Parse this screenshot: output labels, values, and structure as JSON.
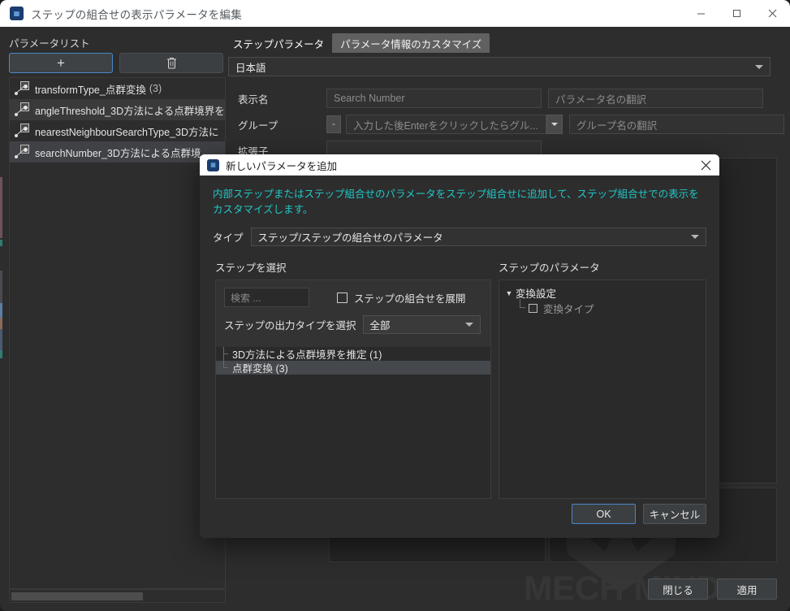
{
  "window": {
    "title": "ステップの組合せの表示パラメータを編集",
    "icon": "app-icon",
    "minimize_label": "minimize-icon",
    "maximize_label": "maximize-icon",
    "close_label": "close-icon"
  },
  "left_pane": {
    "label": "パラメータリスト",
    "add_button": "+",
    "delete_button": "🗑",
    "items": [
      {
        "label": "transformType_点群変換",
        "count": "(3)"
      },
      {
        "label": "angleThreshold_3D方法による点群境界を",
        "count": ""
      },
      {
        "label": "nearestNeighbourSearchType_3D方法に",
        "count": ""
      },
      {
        "label": "searchNumber_3D方法による点群境",
        "count": ""
      }
    ]
  },
  "right_pane": {
    "tabs": [
      {
        "label": "ステップパラメータ",
        "active": true
      },
      {
        "label": "パラメータ情報のカスタマイズ",
        "active": false
      }
    ],
    "language": "日本語",
    "form": {
      "display_name_label": "表示名",
      "display_name_value": "Search Number",
      "display_name_translation": "パラメータ名の翻訳",
      "group_label": "グループ",
      "group_minus": "-",
      "group_value": "入力した後Enterをクリックしたらグル...",
      "group_translation": "グループ名の翻訳",
      "extension_label": "拡張子"
    }
  },
  "main_buttons": {
    "close": "閉じる",
    "apply": "適用"
  },
  "watermark": "MECH MIND",
  "modal": {
    "title": "新しいパラメータを追加",
    "close_icon": "close-icon",
    "description": "内部ステップまたはステップ組合せのパラメータをステップ組合せに追加して、ステップ組合せでの表示をカスタマイズします。",
    "type_label": "タイプ",
    "type_value": "ステップ/ステップの組合せのパラメータ",
    "select_step": {
      "title": "ステップを選択",
      "search_placeholder": "検索 ...",
      "expand_checkbox_label": "ステップの組合せを展開",
      "expand_checked": false,
      "output_type_label": "ステップの出力タイプを選択",
      "output_type_value": "全部",
      "items": [
        {
          "label": "3D方法による点群境界を推定 (1)",
          "selected": false
        },
        {
          "label": "点群変換 (3)",
          "selected": true
        }
      ]
    },
    "step_parameters": {
      "title": "ステップのパラメータ",
      "root": "変換設定",
      "children": [
        {
          "label": "変換タイプ",
          "checked": false
        }
      ]
    },
    "ok_label": "OK",
    "cancel_label": "キャンセル"
  },
  "colors": {
    "accent": "#21c7c7",
    "focus_border": "#4a88c7",
    "window_bg": "#2d2d2d",
    "titlebar_bg": "#ffffff"
  }
}
